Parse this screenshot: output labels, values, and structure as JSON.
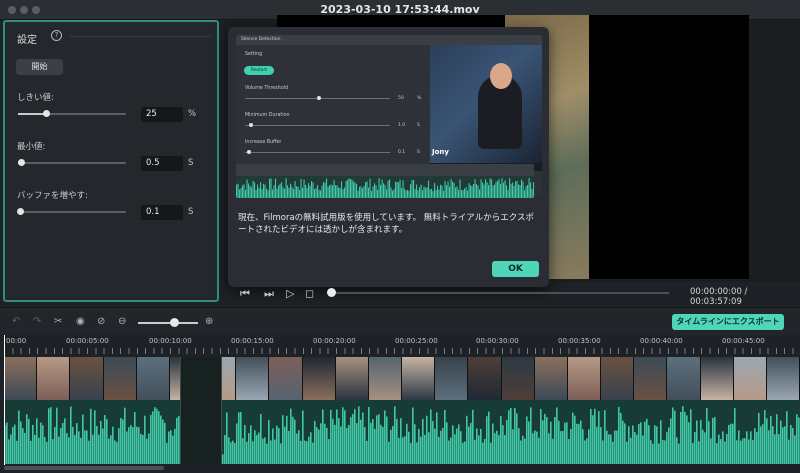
{
  "window": {
    "title": "2023-03-10 17:53:44.mov"
  },
  "settings": {
    "title": "設定",
    "help_icon": "?",
    "start_label": "開始",
    "params": [
      {
        "label": "しきい値:",
        "value": "25",
        "unit": "%",
        "level": 0.25
      },
      {
        "label": "最小値:",
        "value": "0.5",
        "unit": "S",
        "level": 0.03
      },
      {
        "label": "バッファを増やす:",
        "value": "0.1",
        "unit": "S",
        "level": 0.02
      }
    ]
  },
  "dialog": {
    "inner": {
      "title": "Silence Detection",
      "setting_label": "Setting",
      "restart_label": "Restart",
      "params": [
        {
          "label": "Volume Threshold",
          "value": "50",
          "unit": "%"
        },
        {
          "label": "Minimum Duration",
          "value": "1.0",
          "unit": "S"
        },
        {
          "label": "Increase Buffer",
          "value": "0.1",
          "unit": "S"
        }
      ],
      "video_caption": "Jony"
    },
    "message": "現在、Filmoraの無料試用版を使用しています。 無料トライアルからエクスポートされたビデオには透かしが含まれます。",
    "ok_label": "OK"
  },
  "transport": {
    "timecode": "00:00:00:00 / 00:03:57:09"
  },
  "timeline": {
    "export_label": "タイムラインにエクスポート",
    "ruler_labels": [
      "00:00",
      "00:00:05:00",
      "00:00:10:00",
      "00:00:15:00",
      "00:00:20:00",
      "00:00:25:00",
      "00:00:30:00",
      "00:00:35:00",
      "00:00:40:00",
      "00:00:45:00"
    ]
  },
  "colors": {
    "accent": "#4fd6b8",
    "panel_border": "#2f8f7d",
    "audio_wave": "#3fc7a6"
  },
  "icons": [
    "undo-icon",
    "redo-icon",
    "scissors-icon",
    "eye-icon",
    "eye-off-icon",
    "zoom-out-icon",
    "zoom-in-icon",
    "prev-frame-icon",
    "next-frame-icon",
    "play-icon",
    "stop-icon"
  ]
}
